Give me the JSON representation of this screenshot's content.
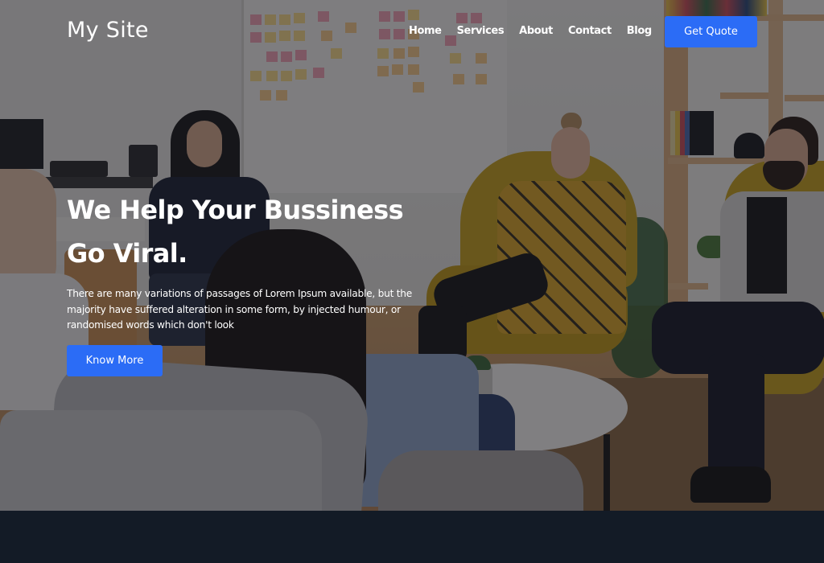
{
  "header": {
    "logo": "My Site",
    "nav": [
      {
        "label": "Home"
      },
      {
        "label": "Services"
      },
      {
        "label": "About"
      },
      {
        "label": "Contact"
      },
      {
        "label": "Blog"
      }
    ],
    "cta_label": "Get Quote"
  },
  "hero": {
    "headline_line1": "We Help Your Bussiness",
    "headline_line2": "Go Viral.",
    "description": "There are many variations of passages of Lorem Ipsum available, but the majority have suffered alteration in some form, by injected humour, or randomised words which don't look",
    "button_label": "Know More",
    "background_image": "office-meeting-photo"
  },
  "colors": {
    "accent": "#2b6cf6",
    "footer_band": "#131b26",
    "text": "#ffffff"
  }
}
